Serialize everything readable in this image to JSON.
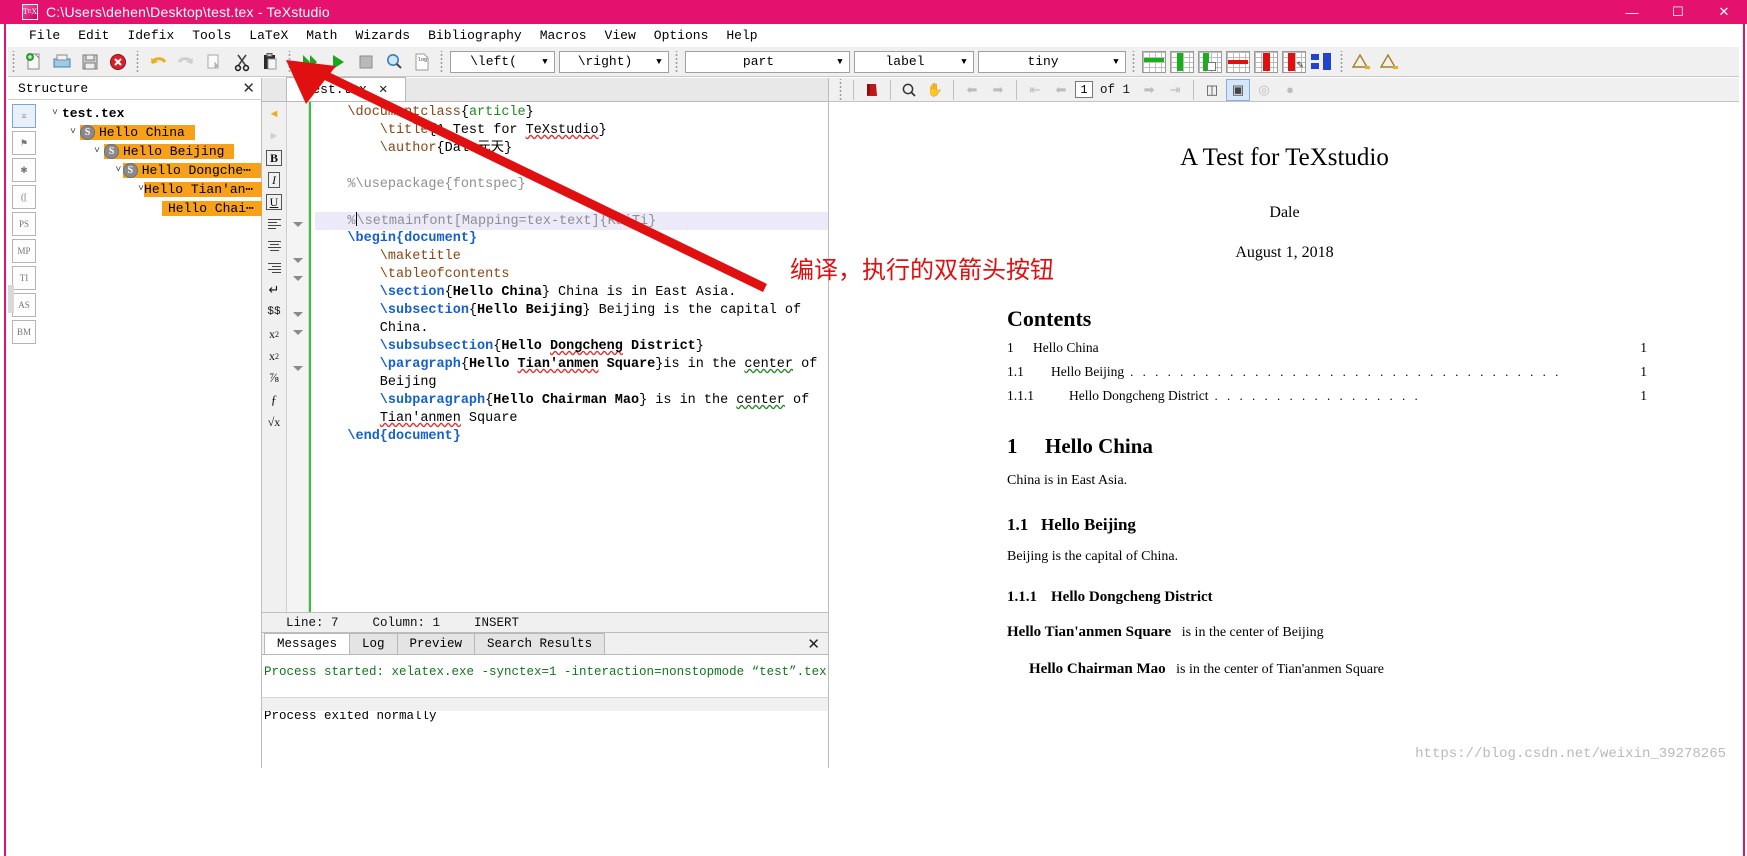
{
  "window": {
    "title": "C:\\Users\\dehen\\Desktop\\test.tex - TeXstudio",
    "app_icon": "texstudio-icon",
    "minimize": "—",
    "maximize": "☐",
    "close": "✕"
  },
  "menubar": {
    "items": [
      {
        "label": "File"
      },
      {
        "label": "Edit"
      },
      {
        "label": "Idefix"
      },
      {
        "label": "Tools"
      },
      {
        "label": "LaTeX"
      },
      {
        "label": "Math"
      },
      {
        "label": "Wizards"
      },
      {
        "label": "Bibliography"
      },
      {
        "label": "Macros"
      },
      {
        "label": "View"
      },
      {
        "label": "Options"
      },
      {
        "label": "Help"
      }
    ]
  },
  "toolbar": {
    "icons": [
      {
        "name": "new-file-icon"
      },
      {
        "name": "open-file-icon"
      },
      {
        "name": "save-icon"
      },
      {
        "name": "close-document-icon"
      },
      {
        "name": "undo-icon"
      },
      {
        "name": "redo-icon"
      },
      {
        "name": "copy-icon"
      },
      {
        "name": "cut-icon"
      },
      {
        "name": "paste-icon"
      },
      {
        "name": "build-and-view-icon"
      },
      {
        "name": "compile-icon"
      },
      {
        "name": "stop-icon"
      },
      {
        "name": "view-pdf-icon"
      },
      {
        "name": "view-log-icon"
      }
    ],
    "combos": [
      {
        "name": "left-delimiter-combo",
        "value": "\\left("
      },
      {
        "name": "right-delimiter-combo",
        "value": "\\right)"
      },
      {
        "name": "section-level-combo",
        "value": "part"
      },
      {
        "name": "label-combo",
        "value": "label"
      },
      {
        "name": "font-size-combo",
        "value": "tiny"
      }
    ],
    "table_icons": [
      {
        "name": "insert-row-above-icon"
      },
      {
        "name": "insert-column-icon"
      },
      {
        "name": "insert-cell-icon"
      },
      {
        "name": "delete-row-icon"
      },
      {
        "name": "delete-column-icon"
      },
      {
        "name": "remove-cell-icon"
      },
      {
        "name": "align-table-icon"
      }
    ],
    "nav_icons": [
      {
        "name": "previous-change-icon"
      },
      {
        "name": "next-change-icon"
      }
    ]
  },
  "structure": {
    "panel_title": "Structure",
    "close_label": "✕",
    "rail": [
      {
        "name": "structure-view-icon",
        "label": "≡",
        "active": true
      },
      {
        "name": "bookmarks-icon",
        "label": "⚑"
      },
      {
        "name": "symbols-icon",
        "label": "✱"
      },
      {
        "name": "brackets-icon",
        "label": "(["
      },
      {
        "name": "ps-symbols-icon",
        "label": "PS"
      },
      {
        "name": "mp-symbols-icon",
        "label": "MP"
      },
      {
        "name": "tipa-symbols-icon",
        "label": "TI"
      },
      {
        "name": "as-symbols-icon",
        "label": "AS"
      },
      {
        "name": "bm-symbols-icon",
        "label": "BM"
      }
    ],
    "tree": [
      {
        "label": "test.tex",
        "level": 0,
        "chevron": "v",
        "badge": "",
        "highlight": false,
        "bold": true
      },
      {
        "label": "Hello China",
        "level": 1,
        "chevron": "v",
        "badge": "S",
        "highlight": true,
        "bold": false
      },
      {
        "label": "Hello Beijing",
        "level": 2,
        "chevron": "v",
        "badge": "S",
        "highlight": true,
        "bold": false
      },
      {
        "label": "Hello Dongche⋯",
        "level": 3,
        "chevron": "v",
        "badge": "S",
        "highlight": true,
        "bold": false
      },
      {
        "label": "Hello Tian'an⋯",
        "level": 4,
        "chevron": "v",
        "badge": "",
        "highlight": true,
        "bold": false
      },
      {
        "label": "Hello Chai⋯",
        "level": 5,
        "chevron": "",
        "badge": "",
        "highlight": true,
        "bold": false
      }
    ]
  },
  "editor": {
    "tab": {
      "label": "test.tex",
      "close": "✕"
    },
    "format_rail": [
      {
        "name": "bookmark-prev-icon",
        "label": "◀"
      },
      {
        "name": "bookmark-next-icon",
        "label": "▶"
      },
      {
        "name": "bold-icon",
        "label": "B"
      },
      {
        "name": "italic-icon",
        "label": "I"
      },
      {
        "name": "underline-icon",
        "label": "U"
      },
      {
        "name": "align-left-icon",
        "label": "≡"
      },
      {
        "name": "align-center-icon",
        "label": "≡"
      },
      {
        "name": "align-right-icon",
        "label": "≡"
      },
      {
        "name": "newline-icon",
        "label": "↵"
      },
      {
        "name": "inline-math-icon",
        "label": "$$"
      },
      {
        "name": "subscript-icon",
        "label": "x₂"
      },
      {
        "name": "superscript-icon",
        "label": "x²"
      },
      {
        "name": "frac-icon",
        "label": "⅟"
      },
      {
        "name": "dfrac-icon",
        "label": "ƒ"
      },
      {
        "name": "sqrt-icon",
        "label": "√x"
      }
    ],
    "status": {
      "line": "Line: 7",
      "column": "Column: 1",
      "mode": "INSERT"
    },
    "code": [
      {
        "line": 1,
        "tokens": [
          {
            "t": "\\documentclass",
            "c": "cmd"
          },
          {
            "t": "{",
            "c": "brace"
          },
          {
            "t": "article",
            "c": "green"
          },
          {
            "t": "}",
            "c": "brace"
          }
        ]
      },
      {
        "line": 2,
        "indent": 4,
        "tokens": [
          {
            "t": "\\title",
            "c": "cmd"
          },
          {
            "t": "{A Test for ",
            "c": "plain"
          },
          {
            "t": "TeXstudio",
            "c": "spell"
          },
          {
            "t": "}",
            "c": "plain"
          }
        ]
      },
      {
        "line": 3,
        "indent": 4,
        "tokens": [
          {
            "t": "\\author",
            "c": "cmd"
          },
          {
            "t": "{Dale元天}",
            "c": "plain"
          }
        ]
      },
      {
        "line": 4,
        "tokens": []
      },
      {
        "line": 5,
        "tokens": [
          {
            "t": "%\\usepackage{fontspec}",
            "c": "cmt"
          }
        ]
      },
      {
        "line": 6,
        "tokens": []
      },
      {
        "line": 7,
        "highlight": true,
        "tokens": [
          {
            "t": "%",
            "c": "cmt"
          },
          {
            "t": "\\setmainfont[Mapping=tex-text]{KaiTi}",
            "c": "cmt"
          }
        ]
      },
      {
        "line": 8,
        "fold": true,
        "tokens": [
          {
            "t": "\\begin",
            "c": "blue"
          },
          {
            "t": "{document}",
            "c": "blue"
          }
        ]
      },
      {
        "line": 9,
        "indent": 4,
        "tokens": [
          {
            "t": "\\maketitle",
            "c": "cmd"
          }
        ]
      },
      {
        "line": 10,
        "indent": 4,
        "tokens": [
          {
            "t": "\\tableofcontents",
            "c": "cmd"
          }
        ]
      },
      {
        "line": 11,
        "indent": 4,
        "fold": true,
        "tokens": [
          {
            "t": "\\section",
            "c": "blue"
          },
          {
            "t": "{",
            "c": "plain"
          },
          {
            "t": "Hello China",
            "c": "bold"
          },
          {
            "t": "} China is in East Asia.",
            "c": "plain"
          }
        ]
      },
      {
        "line": 12,
        "indent": 4,
        "fold": true,
        "tokens": [
          {
            "t": "\\subsection",
            "c": "blue"
          },
          {
            "t": "{",
            "c": "plain"
          },
          {
            "t": "Hello Beijing",
            "c": "bold"
          },
          {
            "t": "} Beijing is the capital of",
            "c": "plain"
          }
        ]
      },
      {
        "line": 13,
        "indent": 4,
        "tokens": [
          {
            "t": "China.",
            "c": "plain"
          }
        ]
      },
      {
        "line": 14,
        "indent": 4,
        "fold": true,
        "tokens": [
          {
            "t": "\\subsubsection",
            "c": "blue"
          },
          {
            "t": "{",
            "c": "plain"
          },
          {
            "t": "Hello ",
            "c": "bold"
          },
          {
            "t": "Dongcheng",
            "c": "boldspell"
          },
          {
            "t": " District}",
            "c": "bold"
          }
        ]
      },
      {
        "line": 15,
        "indent": 4,
        "fold": true,
        "tokens": [
          {
            "t": "\\paragraph",
            "c": "blue"
          },
          {
            "t": "{",
            "c": "plain"
          },
          {
            "t": "Hello ",
            "c": "bold"
          },
          {
            "t": "Tian'anmen",
            "c": "boldspell"
          },
          {
            "t": " Square",
            "c": "bold"
          },
          {
            "t": "}is in the ",
            "c": "plain"
          },
          {
            "t": "center",
            "c": "spellg"
          },
          {
            "t": " of",
            "c": "plain"
          }
        ]
      },
      {
        "line": 16,
        "indent": 4,
        "tokens": [
          {
            "t": "Beijing",
            "c": "plain"
          }
        ]
      },
      {
        "line": 17,
        "indent": 4,
        "fold": true,
        "tokens": [
          {
            "t": "\\subparagraph",
            "c": "blue"
          },
          {
            "t": "{",
            "c": "plain"
          },
          {
            "t": "Hello Chairman Mao",
            "c": "bold"
          },
          {
            "t": "} is in the ",
            "c": "plain"
          },
          {
            "t": "center",
            "c": "spellg"
          },
          {
            "t": " of",
            "c": "plain"
          }
        ]
      },
      {
        "line": 18,
        "indent": 4,
        "tokens": [
          {
            "t": "Tian'anmen",
            "c": "spell"
          },
          {
            "t": " Square",
            "c": "plain"
          }
        ]
      },
      {
        "line": 19,
        "tokens": [
          {
            "t": "\\end",
            "c": "blue"
          },
          {
            "t": "{document}",
            "c": "blue"
          }
        ]
      }
    ]
  },
  "messages": {
    "tabs": [
      {
        "label": "Messages",
        "active": true
      },
      {
        "label": "Log",
        "active": false
      },
      {
        "label": "Preview",
        "active": false
      },
      {
        "label": "Search Results",
        "active": false
      }
    ],
    "close_label": "✕",
    "lines": [
      {
        "text": "Process started: xelatex.exe -synctex=1 -interaction=nonstopmode “test”.tex",
        "color": "green"
      },
      {
        "text": "",
        "color": "black"
      },
      {
        "text": "Process exited normally",
        "color": "black"
      }
    ]
  },
  "pdf_viewer": {
    "toolbar": {
      "icons": [
        {
          "name": "pdf-icon"
        },
        {
          "name": "magnify-icon"
        },
        {
          "name": "hand-tool-icon"
        },
        {
          "name": "back-icon"
        },
        {
          "name": "forward-icon"
        },
        {
          "name": "first-page-icon"
        },
        {
          "name": "previous-page-icon"
        },
        {
          "name": "next-page-icon"
        },
        {
          "name": "last-page-icon"
        },
        {
          "name": "fit-width-icon"
        },
        {
          "name": "fit-page-icon"
        },
        {
          "name": "zoom-in-icon"
        },
        {
          "name": "zoom-out-icon"
        }
      ],
      "page_current": "1",
      "page_total": "of 1"
    },
    "document": {
      "title": "A Test for TeXstudio",
      "author": "Dale",
      "date": "August 1, 2018",
      "contents_heading": "Contents",
      "toc": [
        {
          "num": "1",
          "text": "Hello China",
          "page": "1",
          "level": 1
        },
        {
          "num": "1.1",
          "text": "Hello Beijing",
          "page": "1",
          "level": 2
        },
        {
          "num": "1.1.1",
          "text": "Hello Dongcheng District",
          "page": "1",
          "level": 3
        }
      ],
      "sections": [
        {
          "type": "h1",
          "num": "1",
          "title": "Hello China",
          "body": "China is in East Asia."
        },
        {
          "type": "h2",
          "num": "1.1",
          "title": "Hello Beijing",
          "body": "Beijing is the capital of China."
        },
        {
          "type": "h3",
          "num": "1.1.1",
          "title": "Hello Dongcheng District",
          "body": ""
        }
      ],
      "paragraph": {
        "head": "Hello Tian'anmen Square",
        "text": "is in the center of Beijing"
      },
      "subparagraph": {
        "head": "Hello Chairman Mao",
        "text": "is in the center of Tian'anmen Square"
      },
      "watermark": "https://blog.csdn.net/weixin_39278265"
    }
  },
  "annotation": {
    "note": "编译，执行的双箭头按钮",
    "arrow_color": "#e01010"
  }
}
